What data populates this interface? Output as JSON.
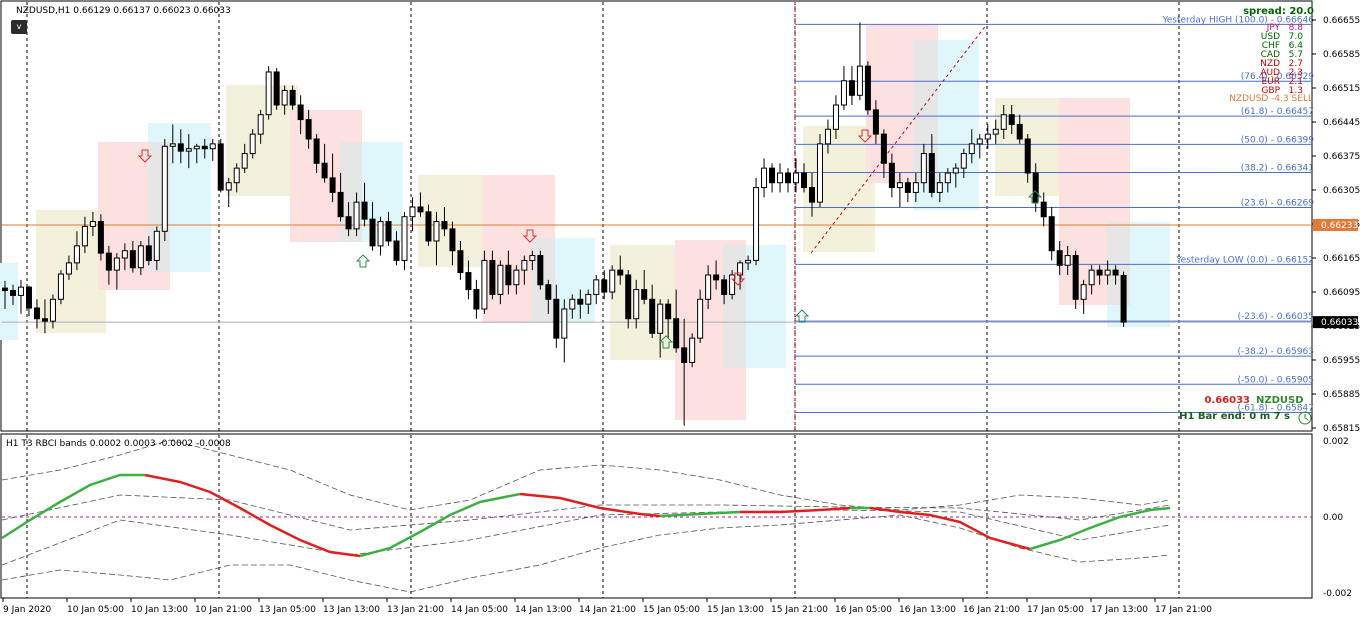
{
  "header": {
    "symbol_info": "NZDUSD,H1  0.66129 0.66137 0.66023 0.66033",
    "toggle_label": "v",
    "spread": "spread: 20.0"
  },
  "strength": [
    {
      "cur": "JPY",
      "val": "8.8",
      "color": "#c71585"
    },
    {
      "cur": "USD",
      "val": "7.0",
      "color": "#006400"
    },
    {
      "cur": "CHF",
      "val": "6.4",
      "color": "#006400"
    },
    {
      "cur": "CAD",
      "val": "5.7",
      "color": "#006400"
    },
    {
      "cur": "NZD",
      "val": "2.7",
      "color": "#cc0000"
    },
    {
      "cur": "AUD",
      "val": "2.3",
      "color": "#cc0000"
    },
    {
      "cur": "EUR",
      "val": "2.1",
      "color": "#cc0000"
    },
    {
      "cur": "GBP",
      "val": "1.3",
      "color": "#cc0000"
    }
  ],
  "signal": "NZDUSD -4.3 SELL",
  "fib_levels": [
    {
      "label": "Yesterday HIGH (100.0) - 0.66646",
      "price": 0.66646
    },
    {
      "label": "(76.4) - 0.66529",
      "price": 0.66529
    },
    {
      "label": "(61.8) - 0.66457",
      "price": 0.66457
    },
    {
      "label": "(50.0) - 0.66399",
      "price": 0.66399
    },
    {
      "label": "(38.2) - 0.66341",
      "price": 0.66341
    },
    {
      "label": "(23.6) - 0.66269",
      "price": 0.66269
    },
    {
      "label": "Yesterday LOW (0.0) - 0.66152",
      "price": 0.66152
    },
    {
      "label": "(-23.6) - 0.66035",
      "price": 0.66035
    },
    {
      "label": "(-38.2) - 0.65963",
      "price": 0.65963
    },
    {
      "label": "(-50.0) - 0.65905",
      "price": 0.65905
    },
    {
      "label": "(-61.8) - 0.65847",
      "price": 0.65847
    }
  ],
  "orange_line_price": "0.66233",
  "current_price": "0.66033",
  "price_axis": [
    "0.66655",
    "0.66585",
    "0.66515",
    "0.66445",
    "0.66375",
    "0.66305",
    "0.66235",
    "0.66165",
    "0.66095",
    "0.66025",
    "0.65955",
    "0.65885",
    "0.65815"
  ],
  "bottom_info": {
    "price": "0.66033",
    "symbol": "NZDUSD",
    "bar_end": "H1 Bar end: 0 m 7 s"
  },
  "indicator": {
    "title": "H1  T3 RBCI bands  0.0002 0.0003 -0.0002 -0.0008",
    "axis": [
      "0.002",
      "0.00",
      "-0.002"
    ]
  },
  "time_axis": [
    "9 Jan 2020",
    "10 Jan 05:00",
    "10 Jan 13:00",
    "10 Jan 21:00",
    "13 Jan 05:00",
    "13 Jan 13:00",
    "13 Jan 21:00",
    "14 Jan 05:00",
    "14 Jan 13:00",
    "14 Jan 21:00",
    "15 Jan 05:00",
    "15 Jan 13:00",
    "15 Jan 21:00",
    "16 Jan 05:00",
    "16 Jan 13:00",
    "16 Jan 21:00",
    "17 Jan 05:00",
    "17 Jan 13:00",
    "17 Jan 21:00"
  ],
  "colors": {
    "bull_zone": "#dff7fb",
    "bear_zone": "#fde0e0",
    "neutral_zone": "#f3f1dc",
    "grey_zone": "#e6e6e6",
    "fib": "#4b6fcf",
    "orange": "#e07b39",
    "rbci_up": "#3cb043",
    "rbci_down": "#e02020"
  }
}
